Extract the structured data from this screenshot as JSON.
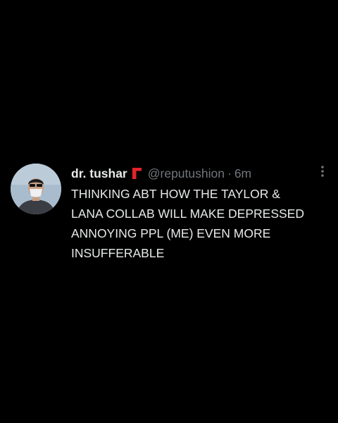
{
  "tweet": {
    "display_name": "dr. tushar",
    "handle": "@reputushion",
    "separator": "·",
    "time": "6m",
    "text": "THINKING ABT HOW THE TAYLOR & LANA COLLAB WILL MAKE DEPRESSED ANNOYING PPL (ME) EVEN MORE INSUFFERABLE"
  },
  "icons": {
    "badge": "red-flag-icon",
    "more": "more-options-icon"
  },
  "colors": {
    "background": "#000000",
    "primary_text": "#e7e9ea",
    "secondary_text": "#71767b",
    "badge": "#e3232b"
  }
}
